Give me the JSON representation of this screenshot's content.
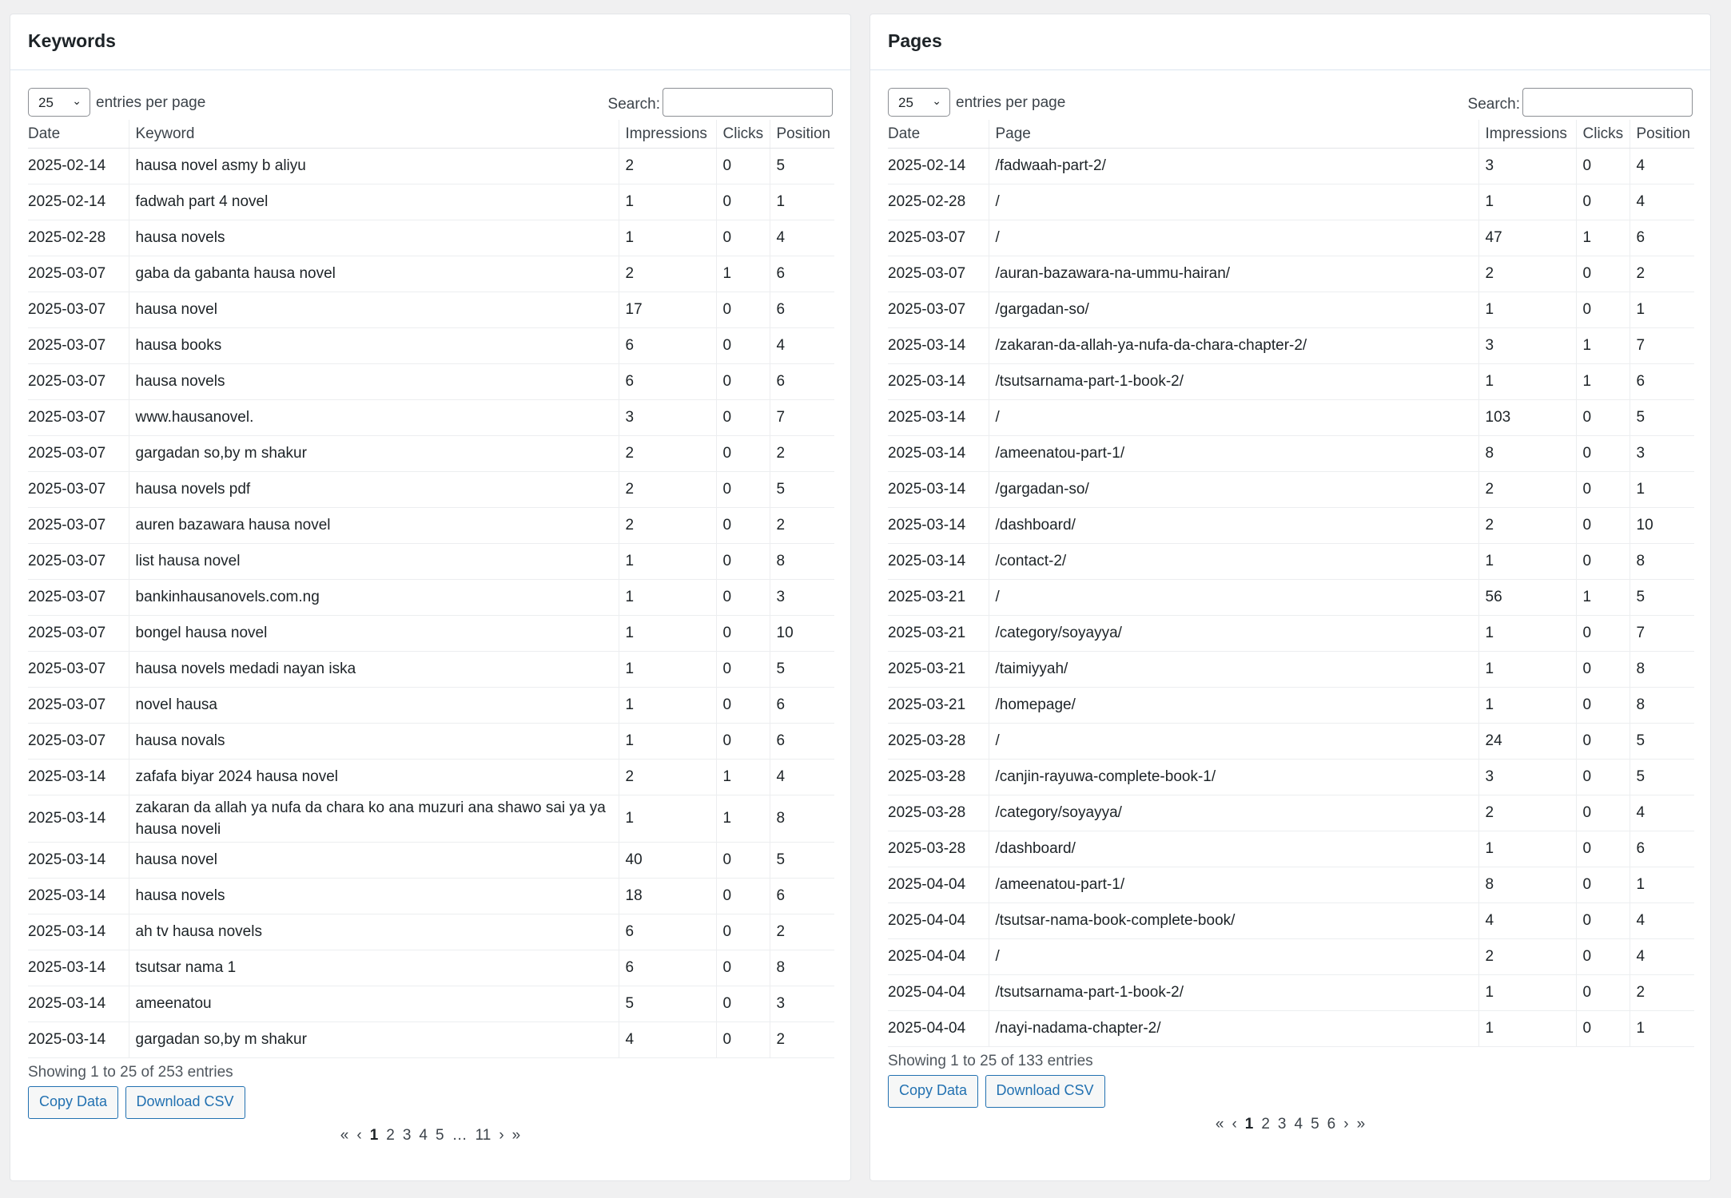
{
  "keywords": {
    "title": "Keywords",
    "page_length": "25",
    "page_length_label": "entries per page",
    "search_label": "Search:",
    "search_value": "",
    "columns": [
      "Date",
      "Keyword",
      "Impressions",
      "Clicks",
      "Position"
    ],
    "rows": [
      [
        "2025-02-14",
        "hausa novel asmy b aliyu",
        "2",
        "0",
        "5"
      ],
      [
        "2025-02-14",
        "fadwah part 4 novel",
        "1",
        "0",
        "1"
      ],
      [
        "2025-02-28",
        "hausa novels",
        "1",
        "0",
        "4"
      ],
      [
        "2025-03-07",
        "gaba da gabanta hausa novel",
        "2",
        "1",
        "6"
      ],
      [
        "2025-03-07",
        "hausa novel",
        "17",
        "0",
        "6"
      ],
      [
        "2025-03-07",
        "hausa books",
        "6",
        "0",
        "4"
      ],
      [
        "2025-03-07",
        "hausa novels",
        "6",
        "0",
        "6"
      ],
      [
        "2025-03-07",
        "www.hausanovel.",
        "3",
        "0",
        "7"
      ],
      [
        "2025-03-07",
        "gargadan so,by m shakur",
        "2",
        "0",
        "2"
      ],
      [
        "2025-03-07",
        "hausa novels pdf",
        "2",
        "0",
        "5"
      ],
      [
        "2025-03-07",
        "auren bazawara hausa novel",
        "2",
        "0",
        "2"
      ],
      [
        "2025-03-07",
        "list hausa novel",
        "1",
        "0",
        "8"
      ],
      [
        "2025-03-07",
        "bankinhausanovels.com.ng",
        "1",
        "0",
        "3"
      ],
      [
        "2025-03-07",
        "bongel hausa novel",
        "1",
        "0",
        "10"
      ],
      [
        "2025-03-07",
        "hausa novels medadi nayan iska",
        "1",
        "0",
        "5"
      ],
      [
        "2025-03-07",
        "novel hausa",
        "1",
        "0",
        "6"
      ],
      [
        "2025-03-07",
        "hausa novals",
        "1",
        "0",
        "6"
      ],
      [
        "2025-03-14",
        "zafafa biyar 2024 hausa novel",
        "2",
        "1",
        "4"
      ],
      [
        "2025-03-14",
        "zakaran da allah ya nufa da chara ko ana muzuri ana shawo sai ya ya hausa noveli",
        "1",
        "1",
        "8"
      ],
      [
        "2025-03-14",
        "hausa novel",
        "40",
        "0",
        "5"
      ],
      [
        "2025-03-14",
        "hausa novels",
        "18",
        "0",
        "6"
      ],
      [
        "2025-03-14",
        "ah tv hausa novels",
        "6",
        "0",
        "2"
      ],
      [
        "2025-03-14",
        "tsutsar nama 1",
        "6",
        "0",
        "8"
      ],
      [
        "2025-03-14",
        "ameenatou",
        "5",
        "0",
        "3"
      ],
      [
        "2025-03-14",
        "gargadan so,by m shakur",
        "4",
        "0",
        "2"
      ]
    ],
    "info": "Showing 1 to 25 of 253 entries",
    "copy_label": "Copy Data",
    "csv_label": "Download CSV",
    "pagination": [
      "«",
      "‹",
      "1",
      "2",
      "3",
      "4",
      "5",
      "…",
      "11",
      "›",
      "»"
    ]
  },
  "pages": {
    "title": "Pages",
    "page_length": "25",
    "page_length_label": "entries per page",
    "search_label": "Search:",
    "search_value": "",
    "columns": [
      "Date",
      "Page",
      "Impressions",
      "Clicks",
      "Position"
    ],
    "rows": [
      [
        "2025-02-14",
        "/fadwaah-part-2/",
        "3",
        "0",
        "4"
      ],
      [
        "2025-02-28",
        "/",
        "1",
        "0",
        "4"
      ],
      [
        "2025-03-07",
        "/",
        "47",
        "1",
        "6"
      ],
      [
        "2025-03-07",
        "/auran-bazawara-na-ummu-hairan/",
        "2",
        "0",
        "2"
      ],
      [
        "2025-03-07",
        "/gargadan-so/",
        "1",
        "0",
        "1"
      ],
      [
        "2025-03-14",
        "/zakaran-da-allah-ya-nufa-da-chara-chapter-2/",
        "3",
        "1",
        "7"
      ],
      [
        "2025-03-14",
        "/tsutsarnama-part-1-book-2/",
        "1",
        "1",
        "6"
      ],
      [
        "2025-03-14",
        "/",
        "103",
        "0",
        "5"
      ],
      [
        "2025-03-14",
        "/ameenatou-part-1/",
        "8",
        "0",
        "3"
      ],
      [
        "2025-03-14",
        "/gargadan-so/",
        "2",
        "0",
        "1"
      ],
      [
        "2025-03-14",
        "/dashboard/",
        "2",
        "0",
        "10"
      ],
      [
        "2025-03-14",
        "/contact-2/",
        "1",
        "0",
        "8"
      ],
      [
        "2025-03-21",
        "/",
        "56",
        "1",
        "5"
      ],
      [
        "2025-03-21",
        "/category/soyayya/",
        "1",
        "0",
        "7"
      ],
      [
        "2025-03-21",
        "/taimiyyah/",
        "1",
        "0",
        "8"
      ],
      [
        "2025-03-21",
        "/homepage/",
        "1",
        "0",
        "8"
      ],
      [
        "2025-03-28",
        "/",
        "24",
        "0",
        "5"
      ],
      [
        "2025-03-28",
        "/canjin-rayuwa-complete-book-1/",
        "3",
        "0",
        "5"
      ],
      [
        "2025-03-28",
        "/category/soyayya/",
        "2",
        "0",
        "4"
      ],
      [
        "2025-03-28",
        "/dashboard/",
        "1",
        "0",
        "6"
      ],
      [
        "2025-04-04",
        "/ameenatou-part-1/",
        "8",
        "0",
        "1"
      ],
      [
        "2025-04-04",
        "/tsutsar-nama-book-complete-book/",
        "4",
        "0",
        "4"
      ],
      [
        "2025-04-04",
        "/",
        "2",
        "0",
        "4"
      ],
      [
        "2025-04-04",
        "/tsutsarnama-part-1-book-2/",
        "1",
        "0",
        "2"
      ],
      [
        "2025-04-04",
        "/nayi-nadama-chapter-2/",
        "1",
        "0",
        "1"
      ]
    ],
    "info": "Showing 1 to 25 of 133 entries",
    "copy_label": "Copy Data",
    "csv_label": "Download CSV",
    "pagination": [
      "«",
      "‹",
      "1",
      "2",
      "3",
      "4",
      "5",
      "6",
      "›",
      "»"
    ]
  }
}
